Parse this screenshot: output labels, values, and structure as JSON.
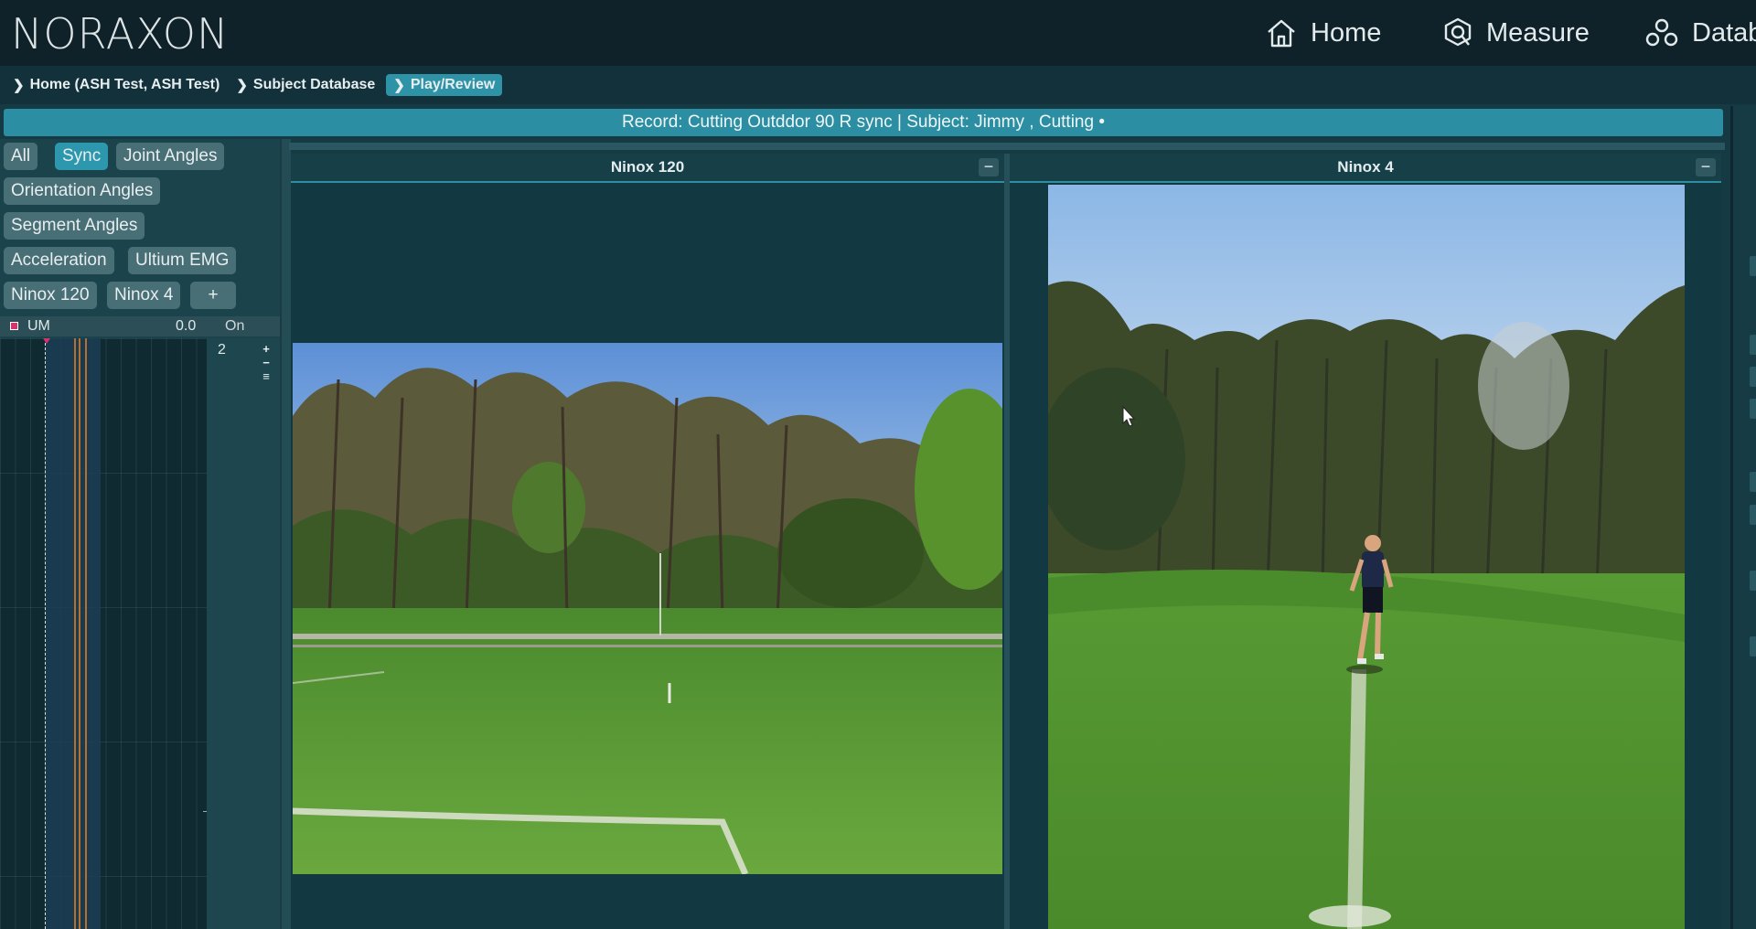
{
  "app": {
    "logo": "NORAXON"
  },
  "nav": {
    "home": "Home",
    "measure": "Measure",
    "database": "Datab"
  },
  "breadcrumb": [
    {
      "label": "Home (ASH Test, ASH Test)"
    },
    {
      "label": "Subject Database"
    },
    {
      "label": "Play/Review",
      "active": true
    }
  ],
  "record_bar": "Record: Cutting Outddor 90 R sync | Subject: Jimmy , Cutting •",
  "filters": {
    "all": "All",
    "sync": "Sync",
    "joint_angles": "Joint Angles",
    "orientation_angles": "Orientation Angles",
    "segment_angles": "Segment Angles",
    "acceleration": "Acceleration",
    "ultium_emg": "Ultium EMG",
    "ninox_120": "Ninox 120",
    "ninox_4": "Ninox 4",
    "add": "+"
  },
  "channel": {
    "name": "UM",
    "value": "0.0",
    "state": "On",
    "scale": "2",
    "zoom_in": "+",
    "zoom_out": "−",
    "menu": "≡"
  },
  "panes": [
    {
      "title": "Ninox 120",
      "minimize": "−"
    },
    {
      "title": "Ninox 4",
      "minimize": "−"
    }
  ],
  "colors": {
    "accent": "#2c8ea2",
    "active_chip": "#2c97ad",
    "channel_marker": "#d8326a"
  }
}
